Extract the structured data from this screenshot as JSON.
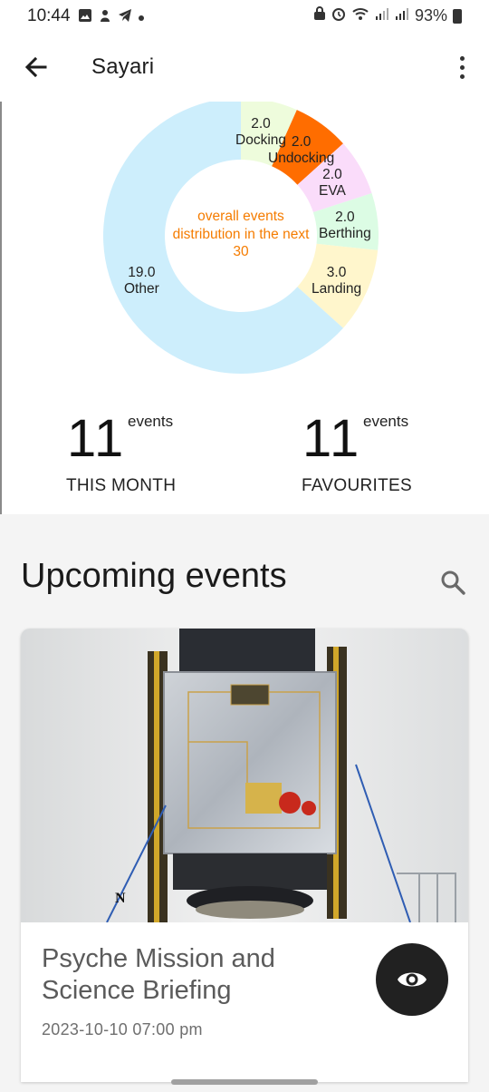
{
  "status_bar": {
    "time": "10:44",
    "battery": "93%",
    "icons_left": [
      "gallery-icon",
      "notification-icon",
      "telegram-icon",
      "dot-icon"
    ],
    "icons_right": [
      "lock-icon",
      "alarm-icon",
      "wifi-icon",
      "signal-icon",
      "signal-icon",
      "battery-icon"
    ]
  },
  "app_bar": {
    "title": "Sayari"
  },
  "donut": {
    "center_label": "overall events distribution in the next 30",
    "segments": [
      {
        "value": "2.0",
        "label": "Docking",
        "value_num": 2,
        "color": "#eefcdc"
      },
      {
        "value": "2.0",
        "label": "Undocking",
        "value_num": 2,
        "color": "#ff6d00"
      },
      {
        "value": "2.0",
        "label": "EVA",
        "value_num": 2,
        "color": "#fadcfa"
      },
      {
        "value": "2.0",
        "label": "Berthing",
        "value_num": 2,
        "color": "#dcfce4"
      },
      {
        "value": "3.0",
        "label": "Landing",
        "value_num": 3,
        "color": "#fff6cc"
      },
      {
        "value": "19.0",
        "label": "Other",
        "value_num": 19,
        "color": "#cdeefc"
      }
    ]
  },
  "stats": {
    "this_month": {
      "number": "11",
      "unit": "events",
      "caption": "THIS MONTH"
    },
    "favourites": {
      "number": "11",
      "unit": "events",
      "caption": "FAVOURITES"
    }
  },
  "upcoming": {
    "title": "Upcoming events",
    "card": {
      "title": "Psyche Mission and Science Briefing",
      "date": "2023-10-10 07:00 pm"
    }
  },
  "colors": {
    "accent_orange": "#f57c00",
    "view_button": "#212121"
  }
}
